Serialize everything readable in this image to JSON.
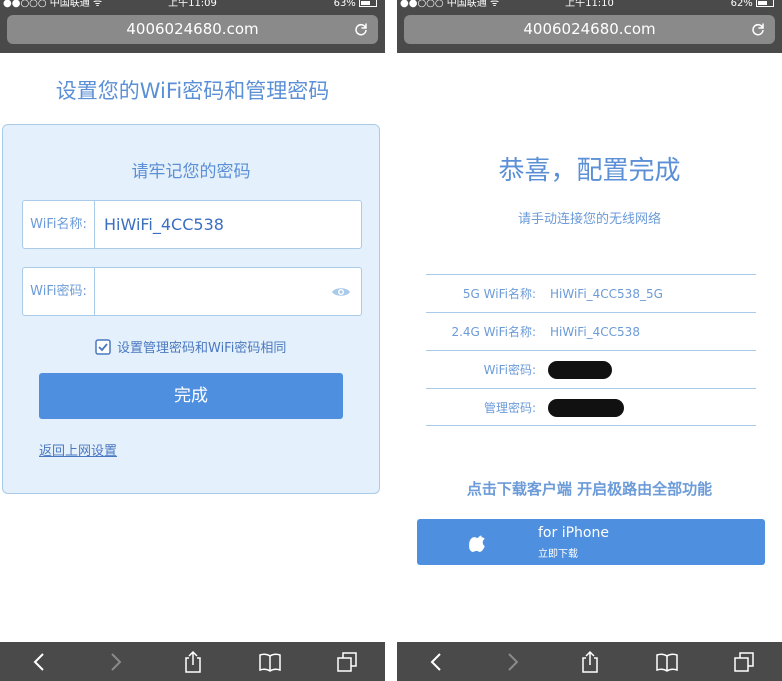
{
  "left": {
    "status_bar": {
      "carrier": "●●○○○ 中国联通 ᯤ",
      "time": "上午11:09",
      "battery": "63%",
      "battery_fraction": 0.63
    },
    "url": "4006024680.com",
    "page_title": "设置您的WiFi密码和管理密码",
    "card_title": "请牢记您的密码",
    "wifi_name_label": "WiFi名称:",
    "wifi_name_value": "HiWiFi_4CC538",
    "wifi_password_label": "WiFi密码:",
    "wifi_password_value": "",
    "checkbox_label": "设置管理密码和WiFi密码相同",
    "checkbox_checked": true,
    "done_button": "完成",
    "back_link": "返回上网设置"
  },
  "right": {
    "status_bar": {
      "carrier": "●●○○○ 中国联通 ᯤ",
      "time": "上午11:10",
      "battery": "62%",
      "battery_fraction": 0.62
    },
    "url": "4006024680.com",
    "title": "恭喜，配置完成",
    "subtitle": "请手动连接您的无线网络",
    "rows": [
      {
        "label": "5G WiFi名称:",
        "value": "HiWiFi_4CC538_5G"
      },
      {
        "label": "2.4G WiFi名称:",
        "value": "HiWiFi_4CC538"
      },
      {
        "label": "WiFi密码:",
        "value": ""
      },
      {
        "label": "管理密码:",
        "value": ""
      }
    ],
    "promo": "点击下载客户端 开启极路由全部功能",
    "iphone_button": {
      "line1": "for iPhone",
      "line2": "立即下载"
    }
  },
  "colors": {
    "accent": "#4e8fe0",
    "text_blue": "#5b8fd6",
    "card_bg": "#e4f0fb",
    "chrome": "#4a4a4a"
  },
  "icons": [
    "reload-icon",
    "back-icon",
    "forward-icon",
    "share-icon",
    "bookmarks-icon",
    "tabs-icon",
    "eye-icon",
    "checkbox-icon",
    "apple-icon"
  ]
}
